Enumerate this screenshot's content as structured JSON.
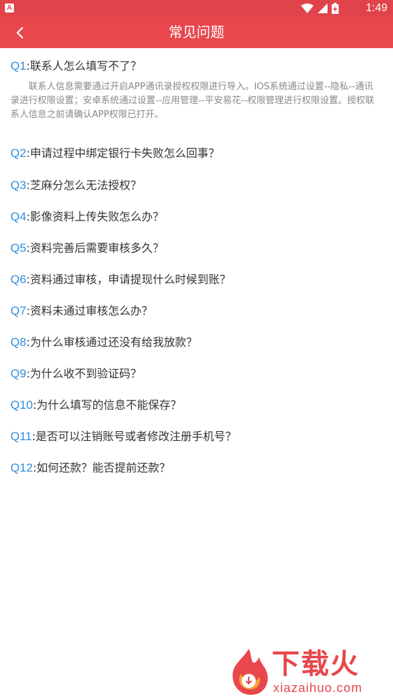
{
  "statusbar": {
    "time": "1:49",
    "app_badge": "A",
    "icons": [
      "wifi-icon",
      "cell-signal-icon",
      "battery-charging-icon"
    ]
  },
  "toolbar": {
    "title": "常见问题",
    "back_icon": "chevron-left-icon",
    "background": "#e8474d"
  },
  "faq": {
    "accent_color": "#2f8ee0",
    "items": [
      {
        "num": "Q1",
        "text": ":联系人怎么填写不了？",
        "answer": "联系人信息需要通过开启APP通讯录授权权限进行导入。IOS系统通过设置--隐私--通讯录进行权限设置；安卓系统通过设置--应用管理--平安易花--权限管理进行权限设置。授权联系人信息之前请确认APP权限已打开。"
      },
      {
        "num": "Q2",
        "text": ":申请过程中绑定银行卡失败怎么回事？"
      },
      {
        "num": "Q3",
        "text": ":芝麻分怎么无法授权？"
      },
      {
        "num": "Q4",
        "text": ":影像资料上传失败怎么办？"
      },
      {
        "num": "Q5",
        "text": ":资料完善后需要审核多久？"
      },
      {
        "num": "Q6",
        "text": ":资料通过审核，申请提现什么时候到账？"
      },
      {
        "num": "Q7",
        "text": ":资料未通过审核怎么办？"
      },
      {
        "num": "Q8",
        "text": ":为什么审核通过还没有给我放款？"
      },
      {
        "num": "Q9",
        "text": ":为什么收不到验证码？"
      },
      {
        "num": "Q10",
        "text": ":为什么填写的信息不能保存？"
      },
      {
        "num": "Q11",
        "text": ":是否可以注销账号或者修改注册手机号？"
      },
      {
        "num": "Q12",
        "text": ":如何还款？能否提前还款？"
      }
    ]
  },
  "watermark": {
    "brand": "下载火",
    "domain": "xiazaihuo.com"
  }
}
